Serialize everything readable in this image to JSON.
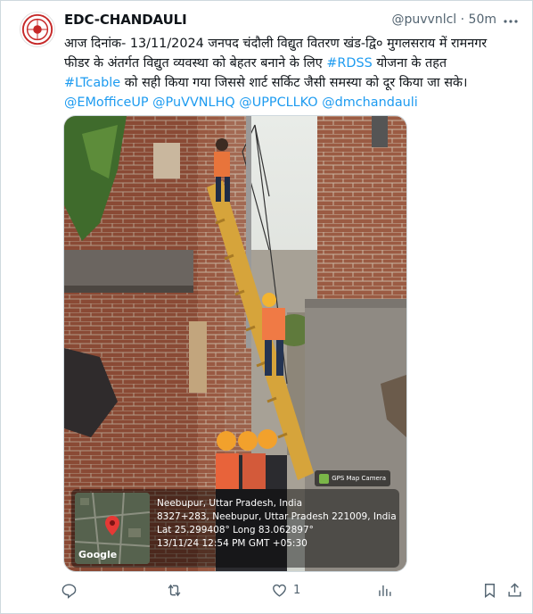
{
  "tweet": {
    "author_name": "EDC-CHANDAULI",
    "handle_time": "@puvvnlcl · 50m",
    "text_lines": [
      [
        "आज दिनांक- 13/11/2024 जनपद चंदौली विद्युत वितरण खंड-द्वि० मुगलसराय में रामनगर"
      ],
      [
        "फीडर के अंतर्गत विद्युत व्यवस्था को बेहतर बनाने के लिए ",
        "#RDSS",
        " योजना के तहत"
      ],
      [
        "#LTcable",
        " को सही किया गया जिससे शार्ट सर्किट जैसी समस्या को दूर किया जा सके।"
      ],
      [
        "@EMofficeUP @PuVVNLHQ @UPPCLLKO @dmchandauli"
      ]
    ],
    "text": {
      "line1": "आज दिनांक- 13/11/2024 जनपद चंदौली विद्युत वितरण खंड-द्वि० मुगलसराय में रामनगर",
      "line2_a": "फीडर के अंतर्गत विद्युत व्यवस्था को बेहतर बनाने के लिए ",
      "line2_tag": "#RDSS",
      "line2_b": " योजना के तहत",
      "line3_tag": "#LTcable",
      "line3_b": " को सही किया गया जिससे शार्ट सर्किट जैसी समस्या को दूर किया जा सके।",
      "line4_mentions": "@EMofficeUP @PuVVNLHQ @UPPCLLKO @dmchandauli"
    },
    "link_color": "#1d9bf0"
  },
  "media": {
    "gps_badge": "GPS Map Camera",
    "map_label": "Google",
    "gps_lines": [
      "Neebupur, Uttar Pradesh, India",
      "8327+283, Neebupur, Uttar Pradesh 221009, India",
      "Lat 25.299408° Long 83.062897°",
      "13/11/24 12:54 PM GMT +05:30"
    ]
  },
  "actions": {
    "reply_count": "",
    "retweet_count": "",
    "like_count": "1",
    "views_count": ""
  },
  "icons": [
    "more-icon",
    "reply-icon",
    "retweet-icon",
    "like-icon",
    "views-icon",
    "bookmark-icon",
    "share-icon"
  ]
}
